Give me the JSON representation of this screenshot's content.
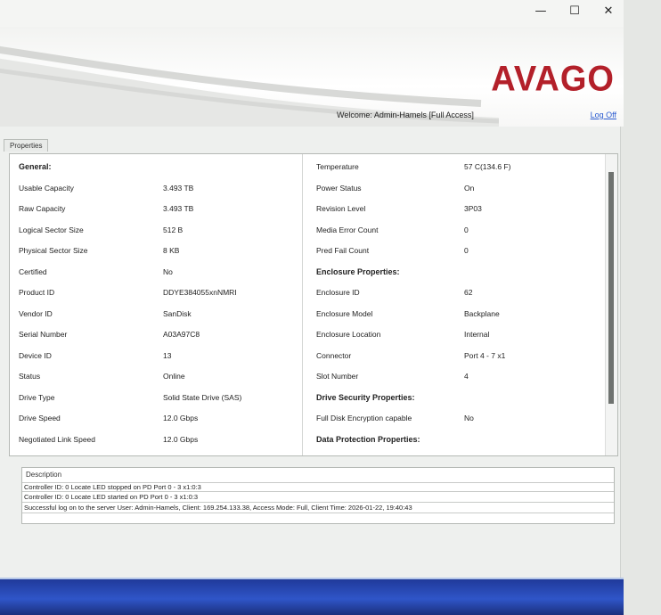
{
  "window": {
    "minimize_glyph": "—",
    "maximize_glyph": "☐",
    "close_glyph": "✕"
  },
  "header": {
    "logo_text": "AVAGO",
    "welcome_text": "Welcome: Admin-Hamels [Full Access]",
    "logoff_label": "Log Off",
    "brand_color": "#b3202a"
  },
  "properties": {
    "tab_label": "Properties",
    "left": [
      {
        "label": "General:",
        "value": "",
        "section": true
      },
      {
        "label": "Usable Capacity",
        "value": "3.493 TB"
      },
      {
        "label": "Raw Capacity",
        "value": "3.493 TB"
      },
      {
        "label": "Logical Sector Size",
        "value": "512 B"
      },
      {
        "label": "Physical Sector Size",
        "value": "8 KB"
      },
      {
        "label": "Certified",
        "value": "No"
      },
      {
        "label": "Product ID",
        "value": "DDYE384055xnNMRI"
      },
      {
        "label": "Vendor ID",
        "value": "SanDisk"
      },
      {
        "label": "Serial Number",
        "value": "A03A97C8"
      },
      {
        "label": "Device ID",
        "value": "13"
      },
      {
        "label": "Status",
        "value": "Online"
      },
      {
        "label": "Drive Type",
        "value": "Solid State Drive (SAS)"
      },
      {
        "label": "Drive Speed",
        "value": "12.0 Gbps"
      },
      {
        "label": "Negotiated Link Speed",
        "value": "12.0 Gbps"
      }
    ],
    "right": [
      {
        "label": "Temperature",
        "value": "57 C(134.6 F)"
      },
      {
        "label": "Power Status",
        "value": "On"
      },
      {
        "label": "Revision Level",
        "value": "3P03"
      },
      {
        "label": "Media Error Count",
        "value": "0"
      },
      {
        "label": "Pred Fail Count",
        "value": "0"
      },
      {
        "label": "Enclosure Properties:",
        "value": "",
        "section": true
      },
      {
        "label": "Enclosure ID",
        "value": "62"
      },
      {
        "label": "Enclosure Model",
        "value": "Backplane"
      },
      {
        "label": "Enclosure Location",
        "value": "Internal"
      },
      {
        "label": "Connector",
        "value": "Port 4 - 7 x1"
      },
      {
        "label": "Slot Number",
        "value": "4"
      },
      {
        "label": "Drive Security Properties:",
        "value": "",
        "section": true
      },
      {
        "label": "Full Disk Encryption capable",
        "value": "No"
      },
      {
        "label": "Data Protection Properties:",
        "value": "",
        "section": true
      }
    ]
  },
  "description": {
    "header": "Description",
    "log_lines": [
      "Controller ID: 0 Locate LED stopped on PD Port 0 - 3 x1:0:3",
      "Controller ID: 0 Locate LED started on PD Port 0 - 3 x1:0:3",
      "Successful log on to the server User:  Admin-Hamels,  Client:  169.254.133.38,    Access Mode:  Full,  Client Time:  2026-01-22, 19:40:43"
    ]
  }
}
